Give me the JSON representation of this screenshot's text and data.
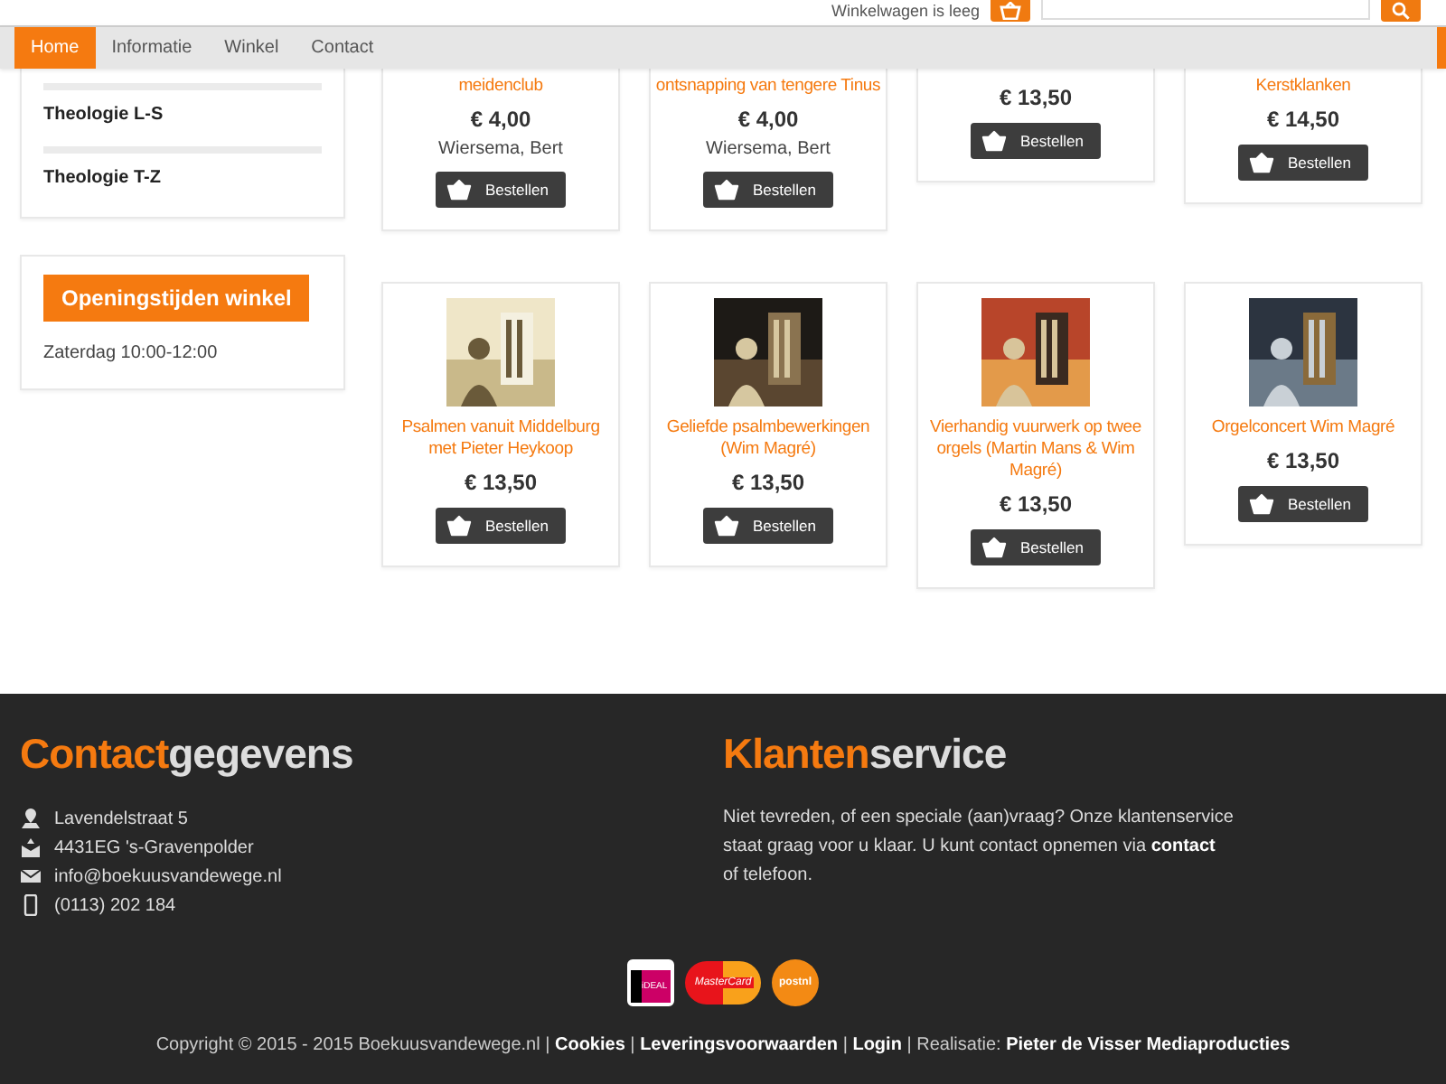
{
  "header": {
    "cart_text": "Winkelwagen is leeg"
  },
  "nav": [
    {
      "label": "Home",
      "selected": true
    },
    {
      "label": "Informatie",
      "selected": false
    },
    {
      "label": "Winkel",
      "selected": false
    },
    {
      "label": "Contact",
      "selected": false
    }
  ],
  "sidebar": {
    "categories": [
      "Theologie L-S",
      "Theologie T-Z"
    ],
    "opening": {
      "title": "Openingstijden winkel",
      "text": "Zaterdag 10:00-12:00"
    }
  },
  "product_rows": [
    [
      {
        "title": "meidenclub",
        "price": "€ 4,00",
        "author": "Wiersema, Bert",
        "button": "Bestellen"
      },
      {
        "title": "ontsnapping van tengere Tinus",
        "price": "€ 4,00",
        "author": "Wiersema, Bert",
        "button": "Bestellen"
      },
      {
        "price": "€ 13,50",
        "button": "Bestellen"
      },
      {
        "title": "Kerstklanken",
        "price": "€ 14,50",
        "button": "Bestellen"
      }
    ],
    [
      {
        "title": "Psalmen vanuit Middelburg met Pieter Heykoop",
        "price": "€ 13,50",
        "button": "Bestellen"
      },
      {
        "title": "Geliefde psalmbewerkingen (Wim Magré)",
        "price": "€ 13,50",
        "button": "Bestellen"
      },
      {
        "title": "Vierhandig vuurwerk op twee orgels (Martin Mans & Wim Magré)",
        "price": "€ 13,50",
        "button": "Bestellen"
      },
      {
        "title": "Orgelconcert Wim Magré",
        "price": "€ 13,50",
        "button": "Bestellen"
      }
    ]
  ],
  "footer": {
    "contact": {
      "heading_accent": "Contact",
      "heading_rest": "gegevens",
      "lines": [
        {
          "kind": "location",
          "text": "Lavendelstraat 5"
        },
        {
          "kind": "post",
          "text": "4431EG 's-Gravenpolder"
        },
        {
          "kind": "email",
          "text": "info@boekuusvandewege.nl"
        },
        {
          "kind": "phone",
          "text": "(0113) 202 184"
        }
      ]
    },
    "service": {
      "heading_accent": "Klanten",
      "heading_rest": "service",
      "text_before": "Niet tevreden, of een speciale (aan)vraag? Onze klantenservice staat graag voor u klaar. U kunt contact opnemen via",
      "link": "contact",
      "text_after": "of telefoon."
    },
    "payment_logos": [
      {
        "kind": "ideal",
        "label": "iDEAL"
      },
      {
        "kind": "mastercard",
        "label": "MasterCard"
      },
      {
        "kind": "postnl",
        "label": "postnl"
      }
    ],
    "copyright": [
      {
        "kind": "text",
        "text": "Copyright © 2015 - 2015 Boekuusvandewege.nl |"
      },
      {
        "kind": "link",
        "text": "Cookies"
      },
      {
        "kind": "text",
        "text": "|"
      },
      {
        "kind": "link",
        "text": "Leveringsvoorwaarden"
      },
      {
        "kind": "text",
        "text": "|"
      },
      {
        "kind": "link",
        "text": "Login"
      },
      {
        "kind": "text",
        "text": "| Realisatie:"
      },
      {
        "kind": "link",
        "text": "Pieter de Visser Mediaproducties"
      }
    ]
  }
}
